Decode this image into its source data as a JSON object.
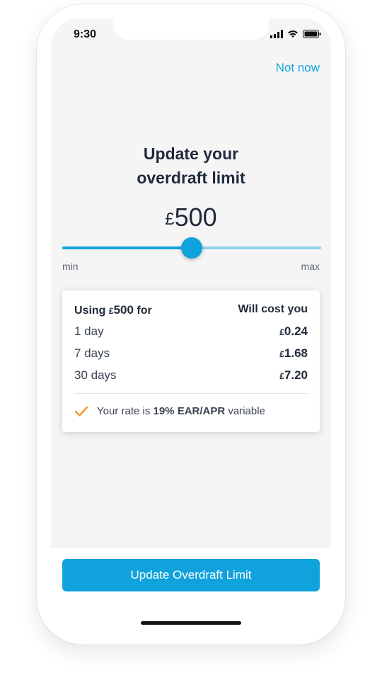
{
  "status_bar": {
    "time": "9:30"
  },
  "header": {
    "dismiss_label": "Not now"
  },
  "title": {
    "line1": "Update your",
    "line2": "overdraft limit"
  },
  "amount": {
    "currency": "£",
    "value": "500"
  },
  "slider": {
    "min_label": "min",
    "max_label": "max",
    "level_fraction": 0.5
  },
  "card": {
    "header_prefix": "Using ",
    "header_currency": "£",
    "header_value": "500",
    "header_suffix": " for",
    "header_right": "Will cost you",
    "rows": [
      {
        "period": "1 day",
        "currency": "£",
        "cost": "0.24"
      },
      {
        "period": "7 days",
        "currency": "£",
        "cost": "1.68"
      },
      {
        "period": "30 days",
        "currency": "£",
        "cost": "7.20"
      }
    ],
    "rate_prefix": "Your rate is ",
    "rate_value": "19% EAR/APR",
    "rate_suffix": " variable"
  },
  "footer": {
    "cta_label": "Update Overdraft Limit"
  },
  "colors": {
    "accent": "#10a2dc",
    "check": "#f29a38",
    "text": "#1f2a3a"
  },
  "icons": [
    "signal-icon",
    "wifi-icon",
    "battery-icon",
    "checkmark-icon"
  ]
}
